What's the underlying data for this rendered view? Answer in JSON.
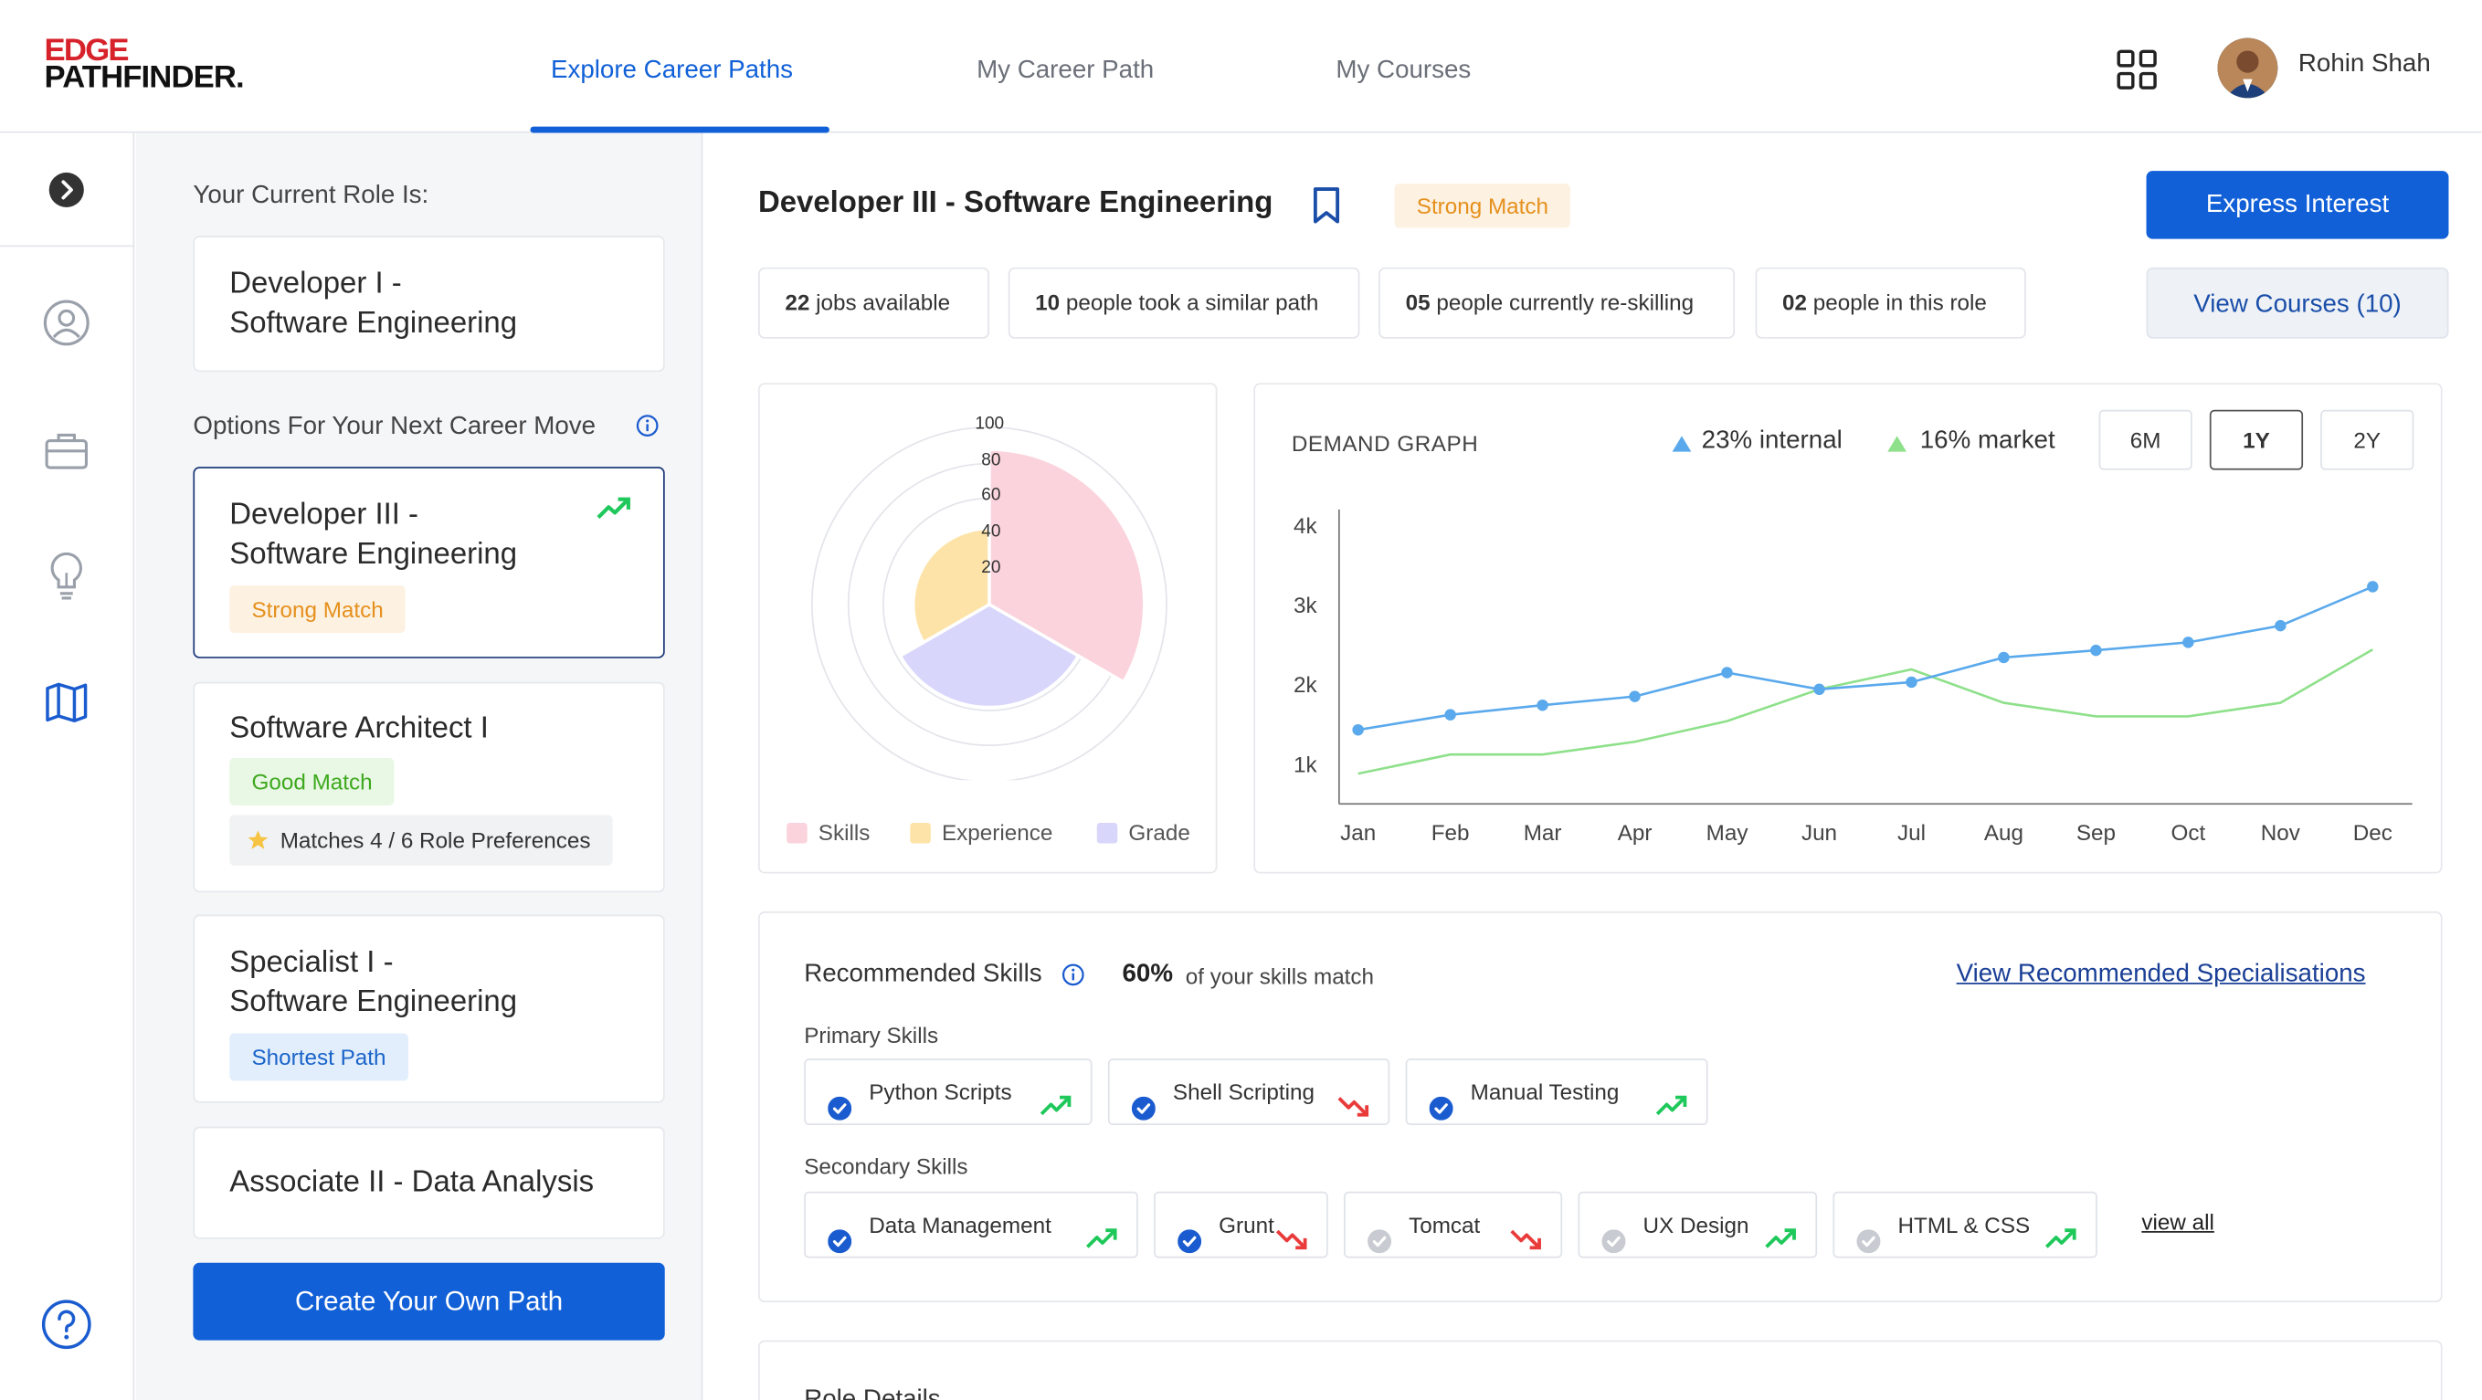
{
  "header": {
    "logo_top": "EDGE",
    "logo_bottom": "PATHFINDER.",
    "tabs": [
      {
        "label": "Explore Career Paths",
        "active": true
      },
      {
        "label": "My Career Path",
        "active": false
      },
      {
        "label": "My Courses",
        "active": false
      }
    ],
    "user_name": "Rohin Shah"
  },
  "rail": {
    "icons": [
      "chevron-right-icon",
      "user-icon",
      "briefcase-icon",
      "lightbulb-icon",
      "map-icon",
      "help-icon"
    ]
  },
  "left": {
    "current_role_label": "Your Current Role Is:",
    "current_role_line1": "Developer I -",
    "current_role_line2": "Software Engineering",
    "options_label": "Options For Your Next Career Move",
    "options": [
      {
        "line1": "Developer III -",
        "line2": "Software Engineering",
        "badge": "Strong Match"
      },
      {
        "line1": "Software Architect I",
        "badge": "Good Match",
        "pref": "Matches 4 / 6 Role Preferences"
      },
      {
        "line1": "Specialist I -",
        "line2": "Software Engineering",
        "badge": "Shortest Path"
      },
      {
        "line1": "Associate II - Data Analysis"
      }
    ],
    "create_button": "Create Your Own Path"
  },
  "role": {
    "title": "Developer III - Software Engineering",
    "match": "Strong Match",
    "express_button": "Express Interest",
    "courses_button": "View Courses (10)",
    "stats": [
      {
        "num": "22",
        "text": " jobs available"
      },
      {
        "num": "10",
        "text": " people took a similar path"
      },
      {
        "num": "05",
        "text": " people currently re-skilling"
      },
      {
        "num": "02",
        "text": " people in this role"
      }
    ]
  },
  "radar": {
    "ticks": [
      "100",
      "80",
      "60",
      "40",
      "20"
    ],
    "legend": [
      "Skills",
      "Experience",
      "Grade"
    ],
    "colors": {
      "skills": "#fbd3dc",
      "experience": "#fde3a7",
      "grade": "#d8d6fb"
    }
  },
  "demand": {
    "title": "DEMAND GRAPH",
    "internal": "23% internal",
    "market": "16% market",
    "ranges": [
      "6M",
      "1Y",
      "2Y"
    ],
    "active_range": "1Y",
    "internal_color": "#5aa9ec",
    "market_color": "#8ee08a"
  },
  "chart_data": {
    "type": "line",
    "title": "DEMAND GRAPH",
    "categories": [
      "Jan",
      "Feb",
      "Mar",
      "Apr",
      "May",
      "Jun",
      "Jul",
      "Aug",
      "Sep",
      "Oct",
      "Nov",
      "Dec"
    ],
    "y_ticks": [
      "4k",
      "3k",
      "2k",
      "1k"
    ],
    "ylim": [
      500,
      4200
    ],
    "series": [
      {
        "name": "23% internal",
        "values": [
          1430,
          1620,
          1740,
          1850,
          2150,
          1940,
          2030,
          2340,
          2430,
          2530,
          2740,
          3230
        ]
      },
      {
        "name": "16% market",
        "values": [
          880,
          1120,
          1120,
          1280,
          1540,
          1940,
          2190,
          1770,
          1600,
          1600,
          1770,
          2440
        ]
      }
    ]
  },
  "skills": {
    "title": "Recommended Skills",
    "match_pct": "60%",
    "match_text": "of your skills match",
    "specialisations_link": "View Recommended Specialisations",
    "primary_label": "Primary Skills",
    "secondary_label": "Secondary Skills",
    "primary": [
      {
        "name": "Python Scripts",
        "checked": true,
        "trend": "up"
      },
      {
        "name": "Shell Scripting",
        "checked": true,
        "trend": "down"
      },
      {
        "name": "Manual Testing",
        "checked": true,
        "trend": "up"
      }
    ],
    "secondary": [
      {
        "name": "Data Management",
        "checked": true,
        "trend": "up"
      },
      {
        "name": "Grunt",
        "checked": true,
        "trend": "down"
      },
      {
        "name": "Tomcat",
        "checked": false,
        "trend": "down"
      },
      {
        "name": "UX Design",
        "checked": false,
        "trend": "up"
      },
      {
        "name": "HTML & CSS",
        "checked": false,
        "trend": "up"
      }
    ],
    "view_all": "view all"
  },
  "role_details_label": "Role Details"
}
